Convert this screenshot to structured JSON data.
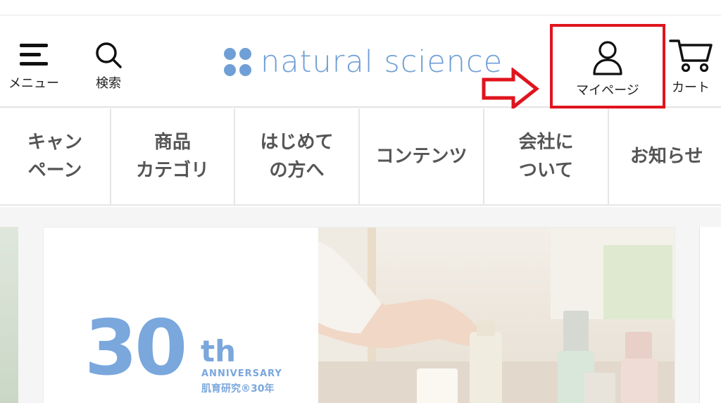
{
  "header": {
    "menu_label": "メニュー",
    "search_label": "検索",
    "logo_text": "natural science",
    "mypage_label": "マイページ",
    "cart_label": "カート"
  },
  "nav": {
    "items": [
      {
        "label": "キャン\nペーン"
      },
      {
        "label": "商品\nカテゴリ"
      },
      {
        "label": "はじめて\nの方へ"
      },
      {
        "label": "コンテンツ"
      },
      {
        "label": "会社に\nついて"
      },
      {
        "label": "お知らせ"
      }
    ]
  },
  "banner": {
    "anniversary_number": "30",
    "anniversary_suffix": "th",
    "anniversary_word": "ANNIVERSARY",
    "anniversary_sub": "肌育研究®30年"
  },
  "colors": {
    "brand": "#6f9fd6",
    "highlight": "#e0141e"
  },
  "icons": {
    "menu": "hamburger-icon",
    "search": "search-icon",
    "mypage": "user-icon",
    "cart": "cart-icon",
    "pointer": "right-arrow-icon"
  }
}
